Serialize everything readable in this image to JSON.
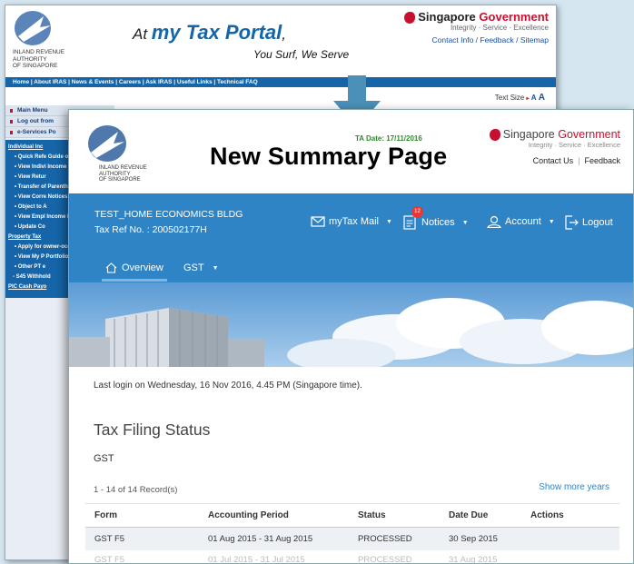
{
  "old_portal": {
    "logo_text": [
      "INLAND REVENUE",
      "AUTHORITY",
      "OF SINGAPORE"
    ],
    "title_prefix": "At",
    "title_brand": "my Tax Portal",
    "title_suffix": ",",
    "tagline": "You Surf, We Serve",
    "gov_name_a": "Singapore",
    "gov_name_b": "Government",
    "gov_motto": "Integrity · Service · Excellence",
    "gov_links": "Contact Info / Feedback / Sitemap",
    "nav": "Home | About IRAS | News & Events | Careers | Ask IRAS | Useful Links | Technical FAQ",
    "text_size_label": "Text Size",
    "text_size_small": "A",
    "text_size_large": "A",
    "sidebar": {
      "main_menu": "Main Menu",
      "logout": "Log out from",
      "eservices": "e-Services Po",
      "items": [
        {
          "text": "Individual Inc",
          "kind": "head"
        },
        {
          "text": "• Quick Refe Guide on I and Relief",
          "kind": "sub"
        },
        {
          "text": "• View Indivi Income Ta Guide",
          "kind": "sub"
        },
        {
          "text": "• View Retur",
          "kind": "sub"
        },
        {
          "text": "• Transfer of Parenthoo Rebate",
          "kind": "sub"
        },
        {
          "text": "• View Corre Notices",
          "kind": "sub"
        },
        {
          "text": "• Object to A",
          "kind": "sub"
        },
        {
          "text": "• View Empl Income Re",
          "kind": "sub"
        },
        {
          "text": "• Update Co",
          "kind": "sub"
        },
        {
          "text": "Property Tax",
          "kind": "head"
        },
        {
          "text": "• Apply for owner-occ tax rates",
          "kind": "sub"
        },
        {
          "text": "• View My P Portfolio/C mailing ad",
          "kind": "sub"
        },
        {
          "text": "• Other PT e",
          "kind": "sub"
        },
        {
          "text": "- S45 Withhold",
          "kind": "plain"
        },
        {
          "text": "PIC Cash Payo",
          "kind": "head"
        }
      ]
    }
  },
  "new_portal": {
    "logo_text": [
      "INLAND REVENUE",
      "AUTHORITY",
      "OF SINGAPORE"
    ],
    "ta_date": "TA Date: 17/11/2016",
    "page_title": "New Summary Page",
    "gov_name_a": "Singapore",
    "gov_name_b": "Government",
    "gov_motto": "Integrity · Service · Excellence",
    "link_contact": "Contact Us",
    "link_feedback": "Feedback",
    "entity_name": "TEST_HOME ECONOMICS BLDG",
    "tax_ref": "Tax Ref No. : 200502177H",
    "nav": {
      "mail": "myTax Mail",
      "notices": "Notices",
      "notices_count": "12",
      "account": "Account",
      "logout": "Logout",
      "caret": "▼"
    },
    "tabs": {
      "overview": "Overview",
      "gst": "GST"
    },
    "last_login": "Last login on Wednesday, 16 Nov 2016, 4.45 PM (Singapore time).",
    "section_title": "Tax Filing Status",
    "section_sub": "GST",
    "records": "1 - 14 of 14 Record(s)",
    "show_more": "Show more years",
    "table": {
      "headers": [
        "Form",
        "Accounting Period",
        "Status",
        "Date Due",
        "Actions"
      ],
      "rows": [
        [
          "GST F5",
          "01 Aug 2015 - 31 Aug 2015",
          "PROCESSED",
          "30 Sep 2015",
          ""
        ],
        [
          "GST F5",
          "01 Jul 2015 - 31 Jul 2015",
          "PROCESSED",
          "31 Aug 2015",
          ""
        ]
      ]
    }
  },
  "colors": {
    "portal_blue": "#2f84c6",
    "old_blue": "#1565a8",
    "gov_red": "#c8102e",
    "ta_green": "#2e8b2e",
    "arrow": "#4a90b8"
  }
}
